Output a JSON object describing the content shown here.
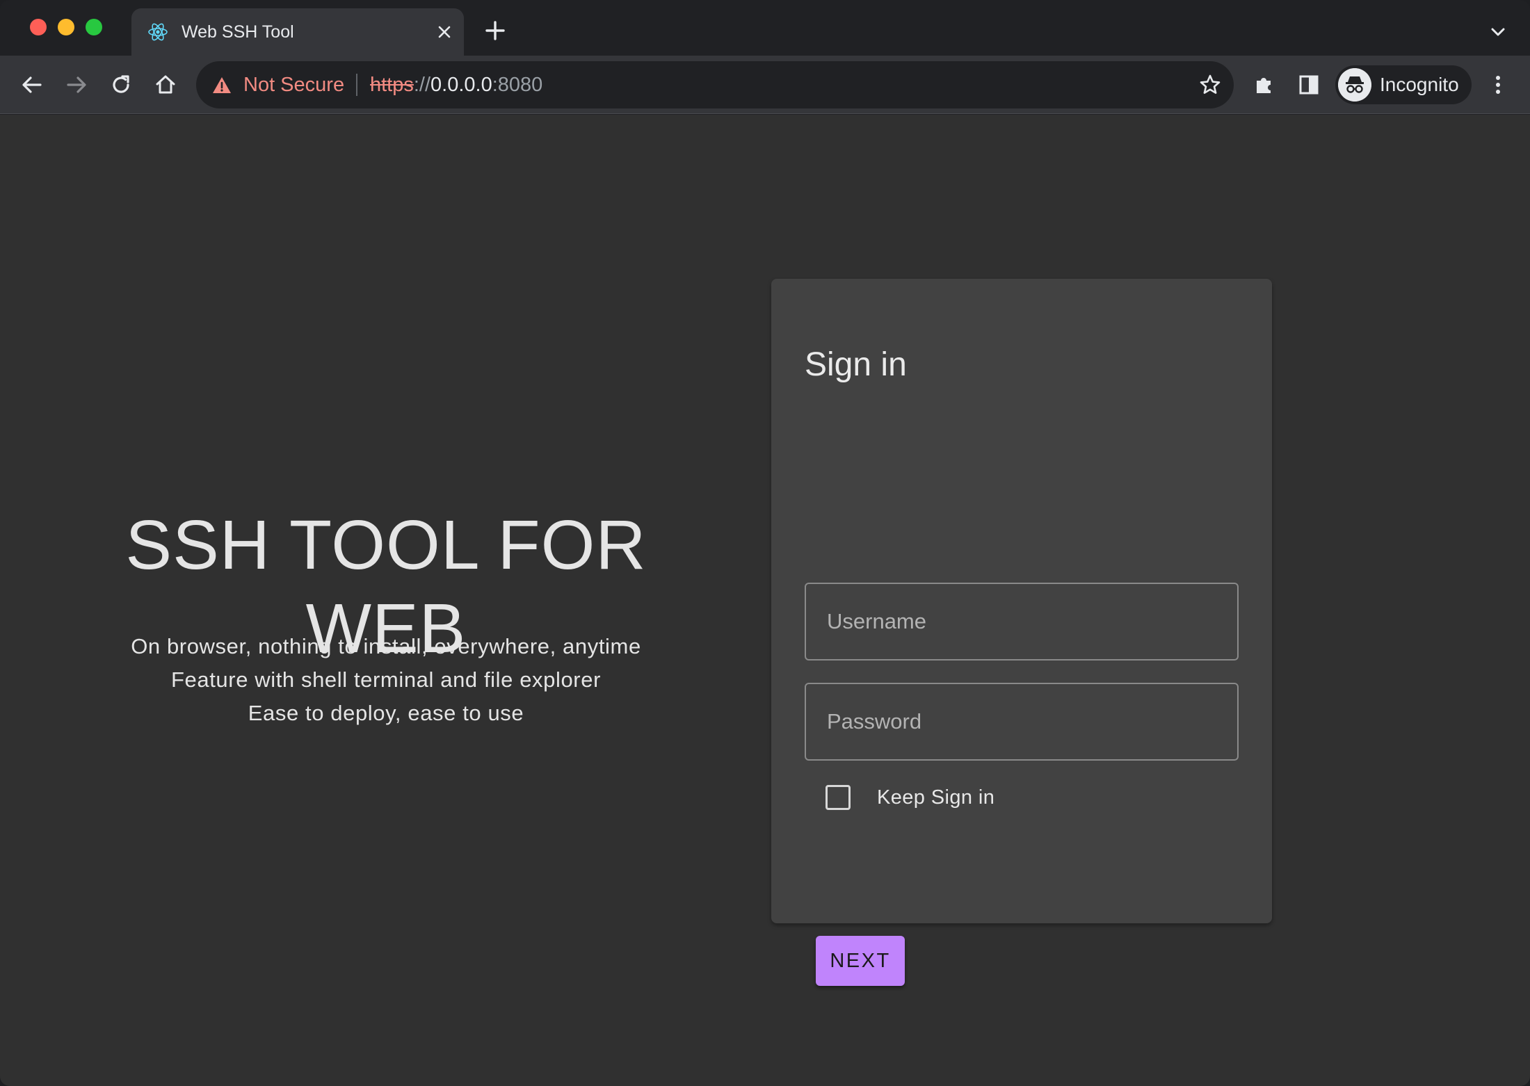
{
  "browser": {
    "tab": {
      "title": "Web SSH Tool",
      "favicon": "react-atom-icon"
    },
    "address_bar": {
      "security_label": "Not Secure",
      "url_scheme": "https",
      "url_separator": "://",
      "url_host": "0.0.0.0",
      "url_port": ":8080"
    },
    "profile": {
      "label": "Incognito"
    },
    "colors": {
      "not_secure": "#f28b82",
      "traffic_close": "#fe5f57",
      "traffic_min": "#febc2e",
      "traffic_max": "#28c840"
    }
  },
  "hero": {
    "title": "SSH TOOL FOR WEB",
    "lines": [
      "On browser, nothing to install, everywhere, anytime",
      "Feature with shell terminal and file explorer",
      "Ease to deploy, ease to use"
    ]
  },
  "signin": {
    "title": "Sign in",
    "username_placeholder": "Username",
    "username_value": "",
    "password_placeholder": "Password",
    "password_value": "",
    "keep_signed_in_label": "Keep Sign in",
    "keep_signed_in_checked": false,
    "next_label": "NEXT",
    "accent_color": "#c084fc"
  }
}
